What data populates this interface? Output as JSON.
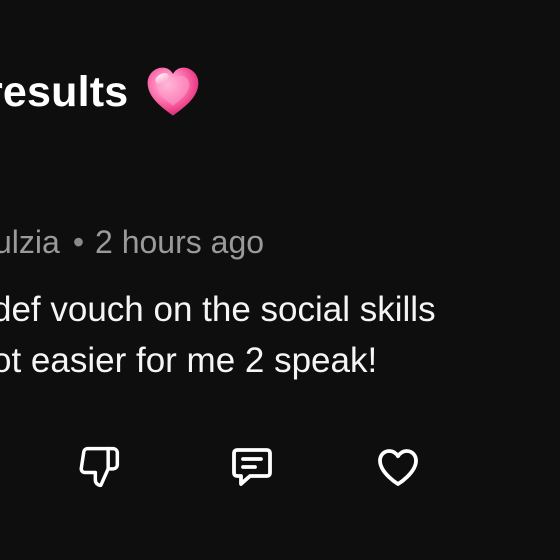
{
  "post": {
    "title": "results"
  },
  "comment": {
    "author": "ulzia",
    "separator": "•",
    "timestamp": "2 hours ago",
    "lines": [
      "def vouch on the social skills",
      "ot easier for me 2 speak!"
    ]
  },
  "actions": {
    "dislike_icon": "thumbs-down-icon",
    "reply_icon": "comment-icon",
    "like_icon": "heart-outline-icon"
  },
  "colors": {
    "background": "#0e0e0e",
    "text": "#ffffff",
    "meta_text": "#9a9a9a",
    "emoji_pink": "#ff5fa2"
  }
}
